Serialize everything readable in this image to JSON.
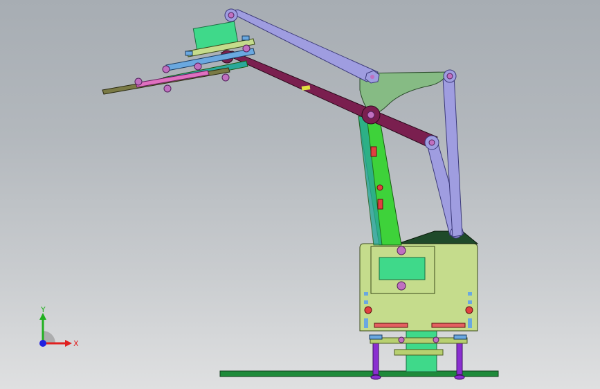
{
  "viewport": {
    "background_top": "#a7adb3",
    "background_bottom": "#dfe0e1"
  },
  "triad": {
    "x_label": "X",
    "y_label": "Y",
    "x_color": "#e02020",
    "y_color": "#20b020",
    "z_color": "#2020e0"
  },
  "colors": {
    "lavender_link": "#9f9de0",
    "maroon_link": "#7a1f4f",
    "green_link": "#3ed23a",
    "sage_plate": "#86bb84",
    "base_body": "#c5dc8c",
    "display": "#3fd98a",
    "base_plate": "#1e8a3a",
    "pillar": "#8a2fd0",
    "gripper_plate": "#7a7a45"
  }
}
